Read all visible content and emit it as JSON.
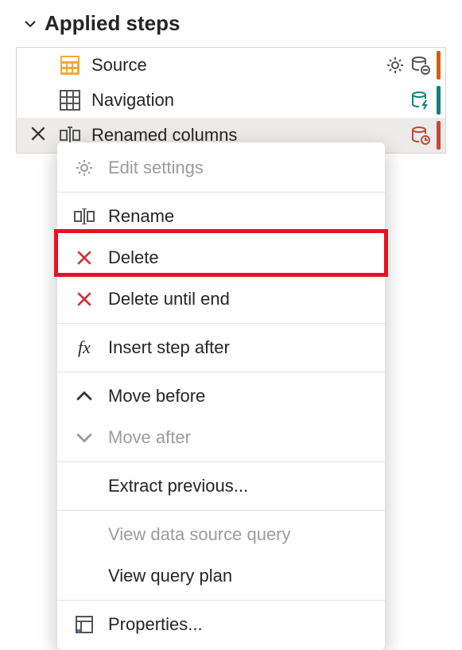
{
  "section_title": "Applied steps",
  "steps": [
    {
      "label": "Source"
    },
    {
      "label": "Navigation"
    },
    {
      "label": "Renamed columns"
    }
  ],
  "menu": {
    "edit_settings": "Edit settings",
    "rename": "Rename",
    "delete": "Delete",
    "delete_until_end": "Delete until end",
    "insert_step_after": "Insert step after",
    "move_before": "Move before",
    "move_after": "Move after",
    "extract_previous": "Extract previous...",
    "view_data_source_query": "View data source query",
    "view_query_plan": "View query plan",
    "properties": "Properties..."
  }
}
